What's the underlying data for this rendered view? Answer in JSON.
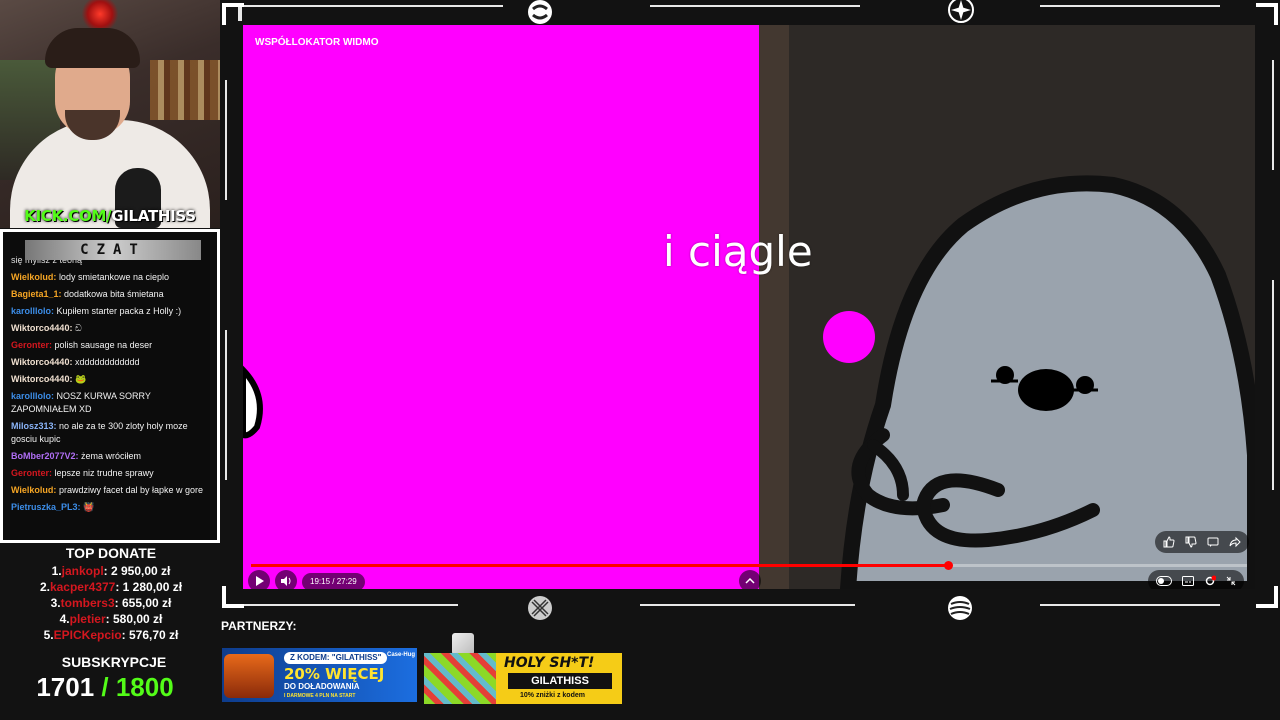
{
  "webcam": {
    "channel_prefix": "KICK.COM/",
    "channel_name": "GILATHISS"
  },
  "chat": {
    "header": "CZAT",
    "partial_first": "się mylisz z teorią",
    "messages": [
      {
        "user": "Wielkolud:",
        "color": "#f5a524",
        "text": "lody smietankowe na cieplo"
      },
      {
        "user": "Bagieta1_1:",
        "color": "#f5a524",
        "text": "dodatkowa bita śmietana"
      },
      {
        "user": "karolllolo:",
        "color": "#3c8de8",
        "text": "Kupiłem starter packa z Holly :)"
      },
      {
        "user": "Wiktorco4440:",
        "color": "#f0e0d0",
        "text": "ඩ"
      },
      {
        "user": "Geronter:",
        "color": "#d4171f",
        "text": "polish sausage na deser"
      },
      {
        "user": "Wiktorco4440:",
        "color": "#f0e0d0",
        "text": "xdddddddddddd"
      },
      {
        "user": "Wiktorco4440:",
        "color": "#f0e0d0",
        "text": "🐸"
      },
      {
        "user": "karolllolo:",
        "color": "#3c8de8",
        "text": "NOSZ KURWA SORRY ZAPOMNIAŁEM XD"
      },
      {
        "user": "Milosz313:",
        "color": "#8ab4f8",
        "text": "no ale za te 300 zloty holy moze gosciu kupic"
      },
      {
        "user": "BoMber2077V2:",
        "color": "#b06ef5",
        "text": "żema wróciłem"
      },
      {
        "user": "Geronter:",
        "color": "#d4171f",
        "text": "lepsze niz trudne sprawy"
      },
      {
        "user": "Wielkolud:",
        "color": "#f5a524",
        "text": "prawdziwy facet dal by łapke w gore"
      },
      {
        "user": "Pietruszka_PL3:",
        "color": "#3c8de8",
        "text": "👹"
      }
    ]
  },
  "donate": {
    "title": "TOP DONATE",
    "entries": [
      {
        "rank": "1.",
        "name": "jankopl",
        "amount": ": 2 950,00 zł"
      },
      {
        "rank": "2.",
        "name": "kacper4377",
        "amount": ": 1 280,00 zł"
      },
      {
        "rank": "3.",
        "name": "tombers3",
        "amount": ": 655,00 zł"
      },
      {
        "rank": "4.",
        "name": "pletier",
        "amount": ": 580,00 zł"
      },
      {
        "rank": "5.",
        "name": "EPICKepcio",
        "amount": ": 576,70 zł"
      }
    ]
  },
  "subs": {
    "title": "SUBSKRYPCJE",
    "current": "1701",
    "goal": " / 1800"
  },
  "video": {
    "title": "WSPÓŁLOKATOR WIDMO",
    "subtitle": "i ciągle",
    "time": "19:15 / 27:29",
    "progress_fraction": 0.7,
    "buffer_fraction": 0.78
  },
  "partners": {
    "label": "PARTNERZY:",
    "p1": {
      "code": "Z KODEM: \"GILATHISS\"",
      "brand": "Case-Hug",
      "big": "20% WIĘCEJ",
      "sub": "DO DOŁADOWANIA",
      "tiny": "I DARMOWE 4 PLN NA START"
    },
    "p2": {
      "title": "HOLY SH*T!",
      "code": "GILATHISS",
      "tiny": "10% zniżki z kodem"
    }
  },
  "colors": {
    "accent_green": "#53fc18",
    "magenta": "#ff00ff",
    "donate_red": "#d4171f",
    "progress_red": "#ff0000"
  },
  "icons": [
    "play-icon",
    "volume-icon",
    "chevron-up-icon",
    "thumbs-up-icon",
    "thumbs-down-icon",
    "comment-icon",
    "share-icon",
    "toggle-icon",
    "captions-icon",
    "settings-icon",
    "fullscreen-icon"
  ]
}
